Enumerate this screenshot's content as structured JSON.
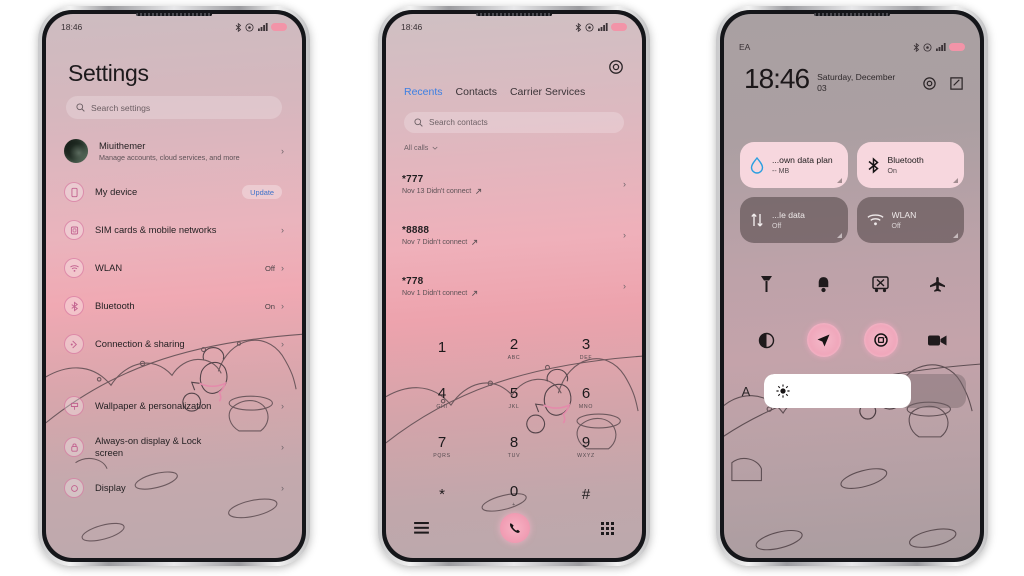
{
  "background_color": "#ffffff",
  "accent": {
    "pink": "#f0a7bb",
    "tile_on": "#f7d7de",
    "link_blue": "#3c7fe3"
  },
  "phone1_settings": {
    "statusbar": {
      "time": "18:46",
      "icons": [
        "bluetooth-icon",
        "mute-icon",
        "signal-icon",
        "battery-icon"
      ]
    },
    "title": "Settings",
    "search": {
      "placeholder": "Search settings",
      "icon": "search-icon"
    },
    "account": {
      "name": "Miuithemer",
      "subtitle": "Manage accounts, cloud services, and more"
    },
    "rows": [
      {
        "label": "My device",
        "value": "Update",
        "icon": "phone-icon",
        "badge": true
      },
      {
        "label": "SIM cards & mobile networks",
        "value": "",
        "icon": "sim-icon"
      },
      {
        "label": "WLAN",
        "value": "Off",
        "icon": "wifi-icon"
      },
      {
        "label": "Bluetooth",
        "value": "On",
        "icon": "bluetooth-icon"
      },
      {
        "label": "Connection & sharing",
        "value": "",
        "icon": "share-icon"
      },
      {
        "label": "Wallpaper & personalization",
        "value": "",
        "icon": "brush-icon"
      },
      {
        "label": "Always-on display & Lock screen",
        "value": "",
        "icon": "lock-icon"
      },
      {
        "label": "Display",
        "value": "",
        "icon": "display-icon"
      }
    ]
  },
  "phone2_dialer": {
    "statusbar": {
      "time": "18:46"
    },
    "settings_icon": "gear-icon",
    "tabs": [
      {
        "label": "Recents",
        "active": true
      },
      {
        "label": "Contacts",
        "active": false
      },
      {
        "label": "Carrier Services",
        "active": false
      }
    ],
    "search": {
      "placeholder": "Search contacts",
      "icon": "search-icon"
    },
    "filter": {
      "label": "All calls",
      "icon": "chevron-down-icon"
    },
    "calls": [
      {
        "number": "*777",
        "meta": "Nov 13 Didn't connect"
      },
      {
        "number": "*8888",
        "meta": "Nov 7 Didn't connect"
      },
      {
        "number": "*778",
        "meta": "Nov 1 Didn't connect"
      }
    ],
    "dialpad": [
      {
        "digit": "1",
        "letters": ""
      },
      {
        "digit": "2",
        "letters": "ABC"
      },
      {
        "digit": "3",
        "letters": "DEF"
      },
      {
        "digit": "4",
        "letters": "GHI"
      },
      {
        "digit": "5",
        "letters": "JKL"
      },
      {
        "digit": "6",
        "letters": "MNO"
      },
      {
        "digit": "7",
        "letters": "PQRS"
      },
      {
        "digit": "8",
        "letters": "TUV"
      },
      {
        "digit": "9",
        "letters": "WXYZ"
      },
      {
        "digit": "*",
        "letters": ""
      },
      {
        "digit": "0",
        "letters": "+"
      },
      {
        "digit": "#",
        "letters": ""
      }
    ],
    "bottom_bar": {
      "menu_icon": "menu-icon",
      "call_icon": "call-icon",
      "keypad_icon": "keypad-icon"
    }
  },
  "phone3_control_center": {
    "statusbar": {
      "carrier": "EA",
      "icons": [
        "bluetooth-icon",
        "mute-icon",
        "signal-icon",
        "battery-icon"
      ]
    },
    "clock": {
      "time": "18:46",
      "date": "Saturday, December 03"
    },
    "header_actions": [
      "camera-icon",
      "edit-icon"
    ],
    "tiles": [
      {
        "title": "...own data plan",
        "subtitle": "-- MB",
        "state": "on",
        "icon": "data-drop-icon"
      },
      {
        "title": "Bluetooth",
        "subtitle": "On",
        "state": "on",
        "icon": "bluetooth-icon"
      },
      {
        "title": "...le data",
        "subtitle": "Off",
        "state": "off",
        "icon": "mobile-data-icon"
      },
      {
        "title": "WLAN",
        "subtitle": "Off",
        "state": "off",
        "icon": "wifi-icon"
      }
    ],
    "toggles": [
      {
        "name": "flashlight-icon",
        "active": false
      },
      {
        "name": "sound-icon",
        "active": false
      },
      {
        "name": "screenshot-icon",
        "active": false
      },
      {
        "name": "airplane-icon",
        "active": false
      },
      {
        "name": "dark-mode-icon",
        "active": false
      },
      {
        "name": "location-icon",
        "active": true
      },
      {
        "name": "auto-rotate-icon",
        "active": true
      },
      {
        "name": "screen-record-icon",
        "active": false
      }
    ],
    "brightness": {
      "auto_label": "A",
      "level_percent": 73,
      "icon": "sun-icon"
    }
  }
}
